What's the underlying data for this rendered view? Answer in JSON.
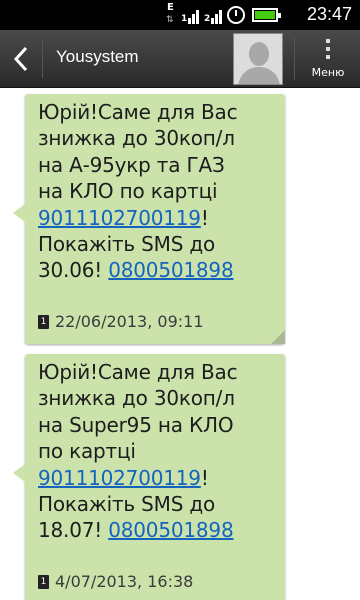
{
  "status_bar": {
    "time": "23:47",
    "data_indicator": "E",
    "signal_icons": [
      "signal-sim1-icon",
      "signal-sim2-icon",
      "alarm-clock-icon",
      "battery-icon"
    ],
    "battery_color": "#44cc11"
  },
  "action_bar": {
    "back_icon": "chevron-left-icon",
    "title": "Yousystem",
    "avatar_icon": "contact-avatar-icon",
    "menu_label": "Меню"
  },
  "colors": {
    "bubble": "#cbe3ab",
    "link": "#1464bf",
    "action_bar": "#3a3a3a"
  },
  "messages": [
    {
      "line1": "Юрій!Саме для Вас",
      "line2": "знижка до 30коп/л",
      "line3": "на А-95укр та ГАЗ",
      "line4": "на КЛО по картці",
      "card_number": "9011102700119",
      "after_card": "!",
      "line6": "Покажіть SMS до",
      "date_text": "30.06! ",
      "phone": "0800501898",
      "sim": "1",
      "timestamp": "22/06/2013, 09:11"
    },
    {
      "line1": "Юрій!Саме для Вас",
      "line2": "знижка до 30коп/л",
      "line3": "на Super95 на КЛО",
      "line4": "по картці",
      "card_number": "9011102700119",
      "after_card": "!",
      "line6": "Покажіть SMS до",
      "date_text": "18.07! ",
      "phone": "0800501898",
      "sim": "1",
      "timestamp": "4/07/2013, 16:38"
    }
  ]
}
